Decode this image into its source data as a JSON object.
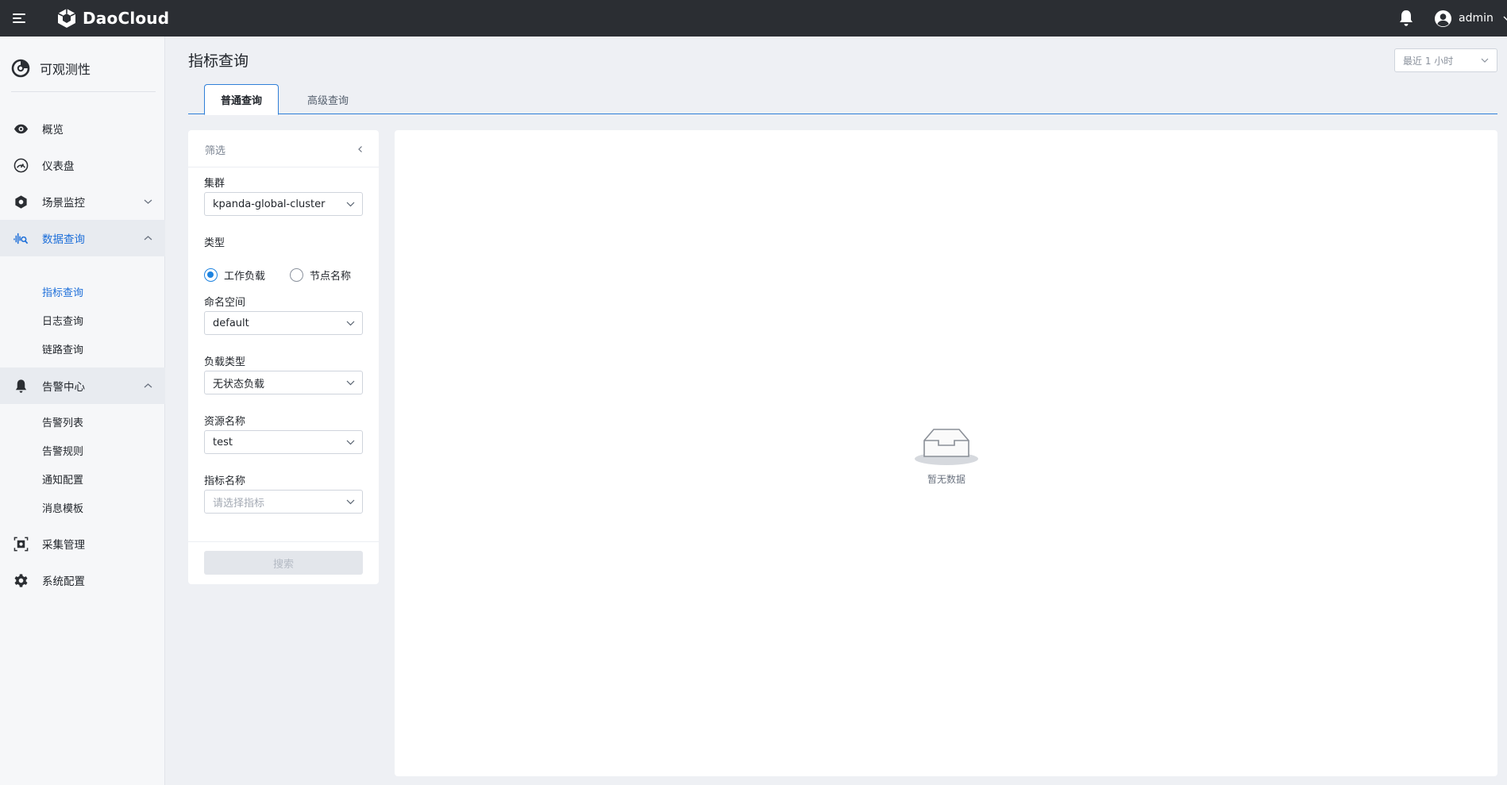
{
  "app": {
    "brand": "DaoCloud",
    "product": "可观测性",
    "user": "admin"
  },
  "sidebar": {
    "items": [
      {
        "label": "概览",
        "icon": "eye-icon"
      },
      {
        "label": "仪表盘",
        "icon": "gauge-icon"
      },
      {
        "label": "场景监控",
        "icon": "hex-gear-icon"
      },
      {
        "label": "数据查询",
        "icon": "waveform-search-icon"
      },
      {
        "label": "告警中心",
        "icon": "bell-icon"
      },
      {
        "label": "采集管理",
        "icon": "collect-icon"
      },
      {
        "label": "系统配置",
        "icon": "gear-icon"
      }
    ],
    "data_query_children": [
      "指标查询",
      "日志查询",
      "链路查询"
    ],
    "alert_children": [
      "告警列表",
      "告警规则",
      "通知配置",
      "消息模板"
    ]
  },
  "page": {
    "title": "指标查询",
    "time_range": "最近 1 小时",
    "tabs": [
      "普通查询",
      "高级查询"
    ]
  },
  "filter": {
    "title": "筛选",
    "cluster_label": "集群",
    "cluster_value": "kpanda-global-cluster",
    "type_label": "类型",
    "type_options": [
      "工作负载",
      "节点名称"
    ],
    "type_selected": "工作负载",
    "namespace_label": "命名空间",
    "namespace_value": "default",
    "workload_type_label": "负载类型",
    "workload_type_value": "无状态负载",
    "resource_label": "资源名称",
    "resource_value": "test",
    "metric_label": "指标名称",
    "metric_placeholder": "请选择指标",
    "search_button": "搜索"
  },
  "result": {
    "empty_text": "暂无数据"
  },
  "colors": {
    "accent": "#1e6fd9",
    "topbar": "#2b2e33",
    "sidebar_bg": "#f6f7f9",
    "page_bg": "#eef0f4"
  }
}
